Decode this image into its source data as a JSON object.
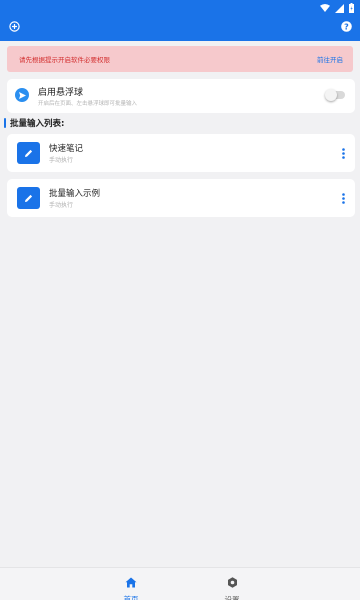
{
  "status_bar": {
    "icons": [
      "wifi-icon",
      "signal-icon",
      "battery-icon"
    ]
  },
  "app_bar": {
    "left_icon": "add-circle-icon",
    "right_icon": "help-icon",
    "color": "#1a73e8"
  },
  "banner": {
    "message": "请先根据提示开启软件必要权限",
    "action": "前往开启",
    "background": "#f6c9cc",
    "message_color": "#d32f2f"
  },
  "float_ball": {
    "title": "启用悬浮球",
    "subtitle": "开启后在页面、左击悬浮球即可批量输入",
    "enabled": false,
    "icon": "send-icon"
  },
  "list": {
    "title": "批量输入列表:",
    "items": [
      {
        "title": "快速笔记",
        "subtitle": "手动执行",
        "icon": "edit-icon"
      },
      {
        "title": "批量输入示例",
        "subtitle": "手动执行",
        "icon": "edit-icon"
      }
    ]
  },
  "bottom_nav": {
    "items": [
      {
        "label": "首页",
        "icon": "home-icon",
        "active": true
      },
      {
        "label": "设置",
        "icon": "settings-icon",
        "active": false
      }
    ]
  }
}
